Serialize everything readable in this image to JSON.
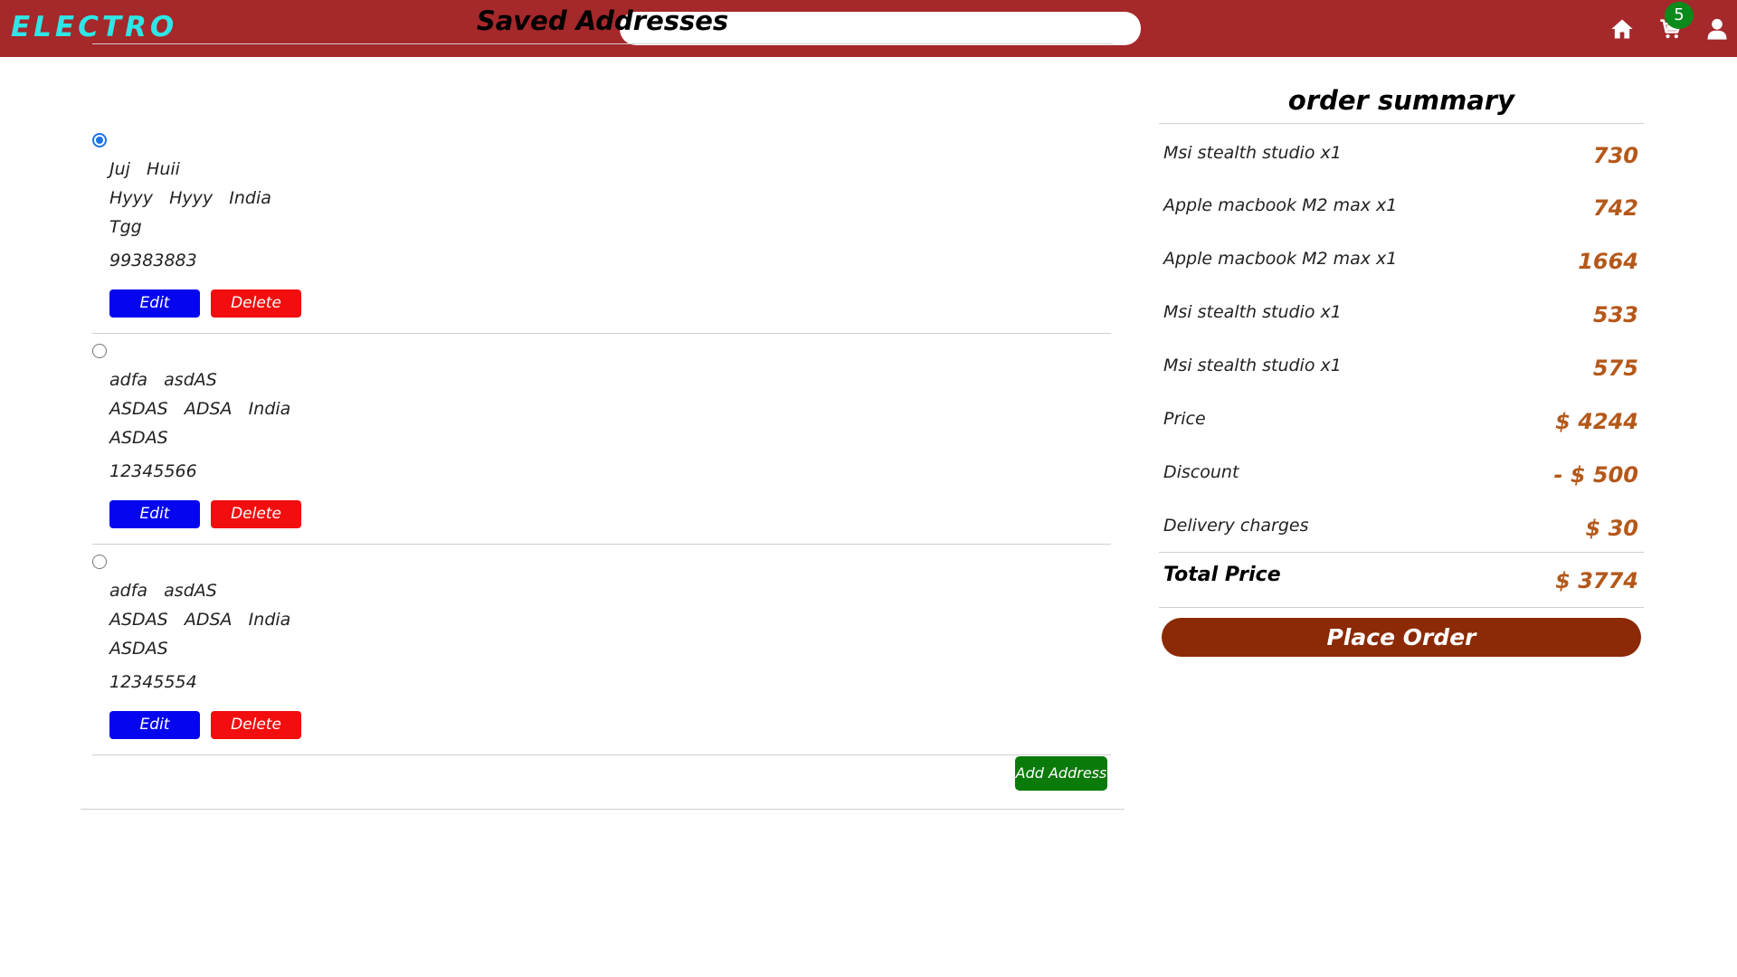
{
  "header": {
    "brand": "ELECTRO",
    "search_placeholder": "",
    "cart_count": "5",
    "icons": [
      "home-icon",
      "cart-icon",
      "user-icon"
    ],
    "colors": {
      "navbar": "#a5282b",
      "brand": "#2ee6e6",
      "badge": "#0a8a1a"
    }
  },
  "addresses": {
    "title": "Saved Addresses",
    "items": [
      {
        "selected": true,
        "name": "Juj   Huii",
        "city_line": "Hyyy   Hyyy   India",
        "street": "Tgg",
        "phone": "99383883",
        "edit_label": "Edit",
        "delete_label": "Delete"
      },
      {
        "selected": false,
        "name": "adfa   asdAS",
        "city_line": "ASDAS   ADSA   India",
        "street": "ASDAS",
        "phone": "12345566",
        "edit_label": "Edit",
        "delete_label": "Delete"
      },
      {
        "selected": false,
        "name": "adfa   asdAS",
        "city_line": "ASDAS   ADSA   India",
        "street": "ASDAS",
        "phone": "12345554",
        "edit_label": "Edit",
        "delete_label": "Delete"
      }
    ],
    "add_label": "Add Address",
    "colors": {
      "edit": "#0505f0",
      "delete": "#f20e0e",
      "add": "#0a7a0a"
    }
  },
  "summary": {
    "title": "order summary",
    "items": [
      {
        "label": "Msi stealth studio x1",
        "value": "730"
      },
      {
        "label": "Apple macbook M2 max x1",
        "value": "742"
      },
      {
        "label": "Apple macbook M2 max x1",
        "value": "1664"
      },
      {
        "label": "Msi stealth studio x1",
        "value": "533"
      },
      {
        "label": "Msi stealth studio x1",
        "value": "575"
      },
      {
        "label": "Price",
        "value": "$ 4244"
      },
      {
        "label": "Discount",
        "value": "- $ 500"
      },
      {
        "label": "Delivery charges",
        "value": "$ 30"
      }
    ],
    "total_label": "Total Price",
    "total_value": "$ 3774",
    "place_order_label": "Place Order",
    "colors": {
      "value": "#b4581a",
      "place_order": "#8b2a04"
    }
  }
}
